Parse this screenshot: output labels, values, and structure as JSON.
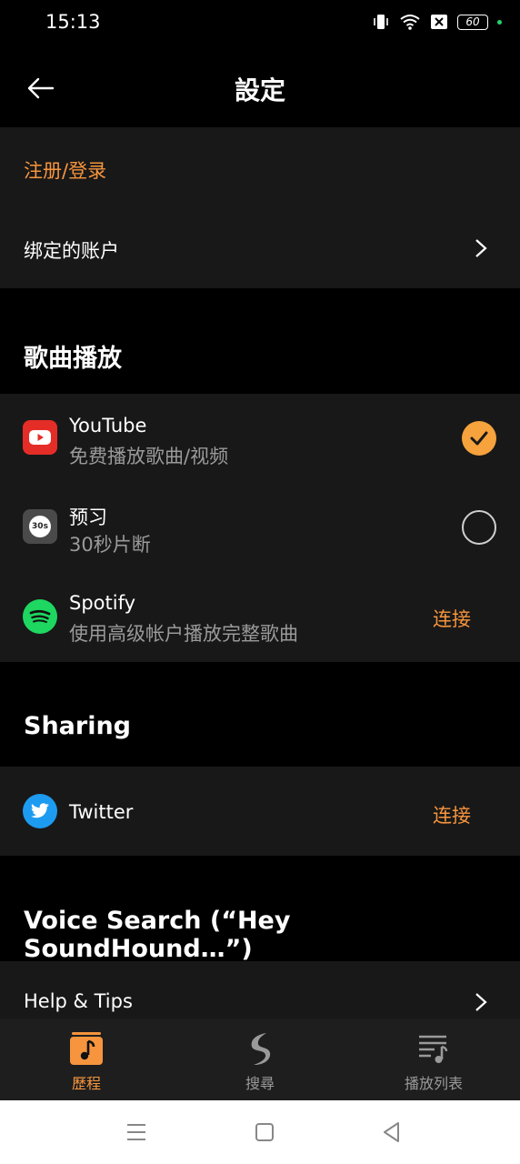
{
  "status_bar": {
    "time": "15:13",
    "battery": "60"
  },
  "header": {
    "title": "設定"
  },
  "account": {
    "login_label": "注册/登录",
    "linked_accounts_label": "绑定的账户"
  },
  "playback": {
    "title": "歌曲播放",
    "items": [
      {
        "title": "YouTube",
        "subtitle": "免费播放歌曲/视频",
        "state": "selected"
      },
      {
        "title": "预习",
        "subtitle": "30秒片断",
        "icon_text": "30s",
        "state": "unselected"
      },
      {
        "title": "Spotify",
        "subtitle": "使用高级帐户播放完整歌曲",
        "action": "连接"
      }
    ]
  },
  "sharing": {
    "title": "Sharing",
    "items": [
      {
        "title": "Twitter",
        "action": "连接"
      }
    ]
  },
  "voice_search": {
    "title": "Voice Search (“Hey SoundHound…”)"
  },
  "help": {
    "label": "Help & Tips"
  },
  "bottom_nav": {
    "items": [
      {
        "label": "歷程",
        "icon": "music-note-icon",
        "active": true
      },
      {
        "label": "搜尋",
        "icon": "soundhound-logo-icon",
        "active": false
      },
      {
        "label": "播放列表",
        "icon": "playlist-icon",
        "active": false
      }
    ]
  },
  "colors": {
    "accent": "#f6953d",
    "card_bg": "#181818",
    "background": "#000000"
  }
}
